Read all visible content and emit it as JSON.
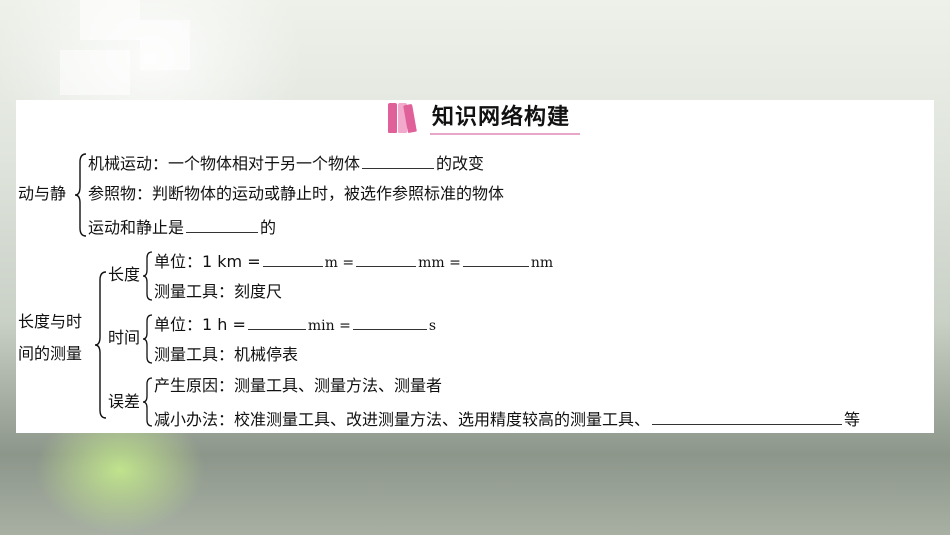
{
  "title": "知识网络构建",
  "section1": {
    "heading": "动与静",
    "line1_pre": "机械运动：一个物体相对于另一个物体",
    "line1_post": "的改变",
    "line2": "参照物：判断物体的运动或静止时，被选作参照标准的物体",
    "line3_pre": "运动和静止是",
    "line3_post": "的"
  },
  "section2": {
    "heading_line1": "长度与时",
    "heading_line2": "间的测量",
    "length": {
      "label": "长度",
      "unit_pre": "单位：1 km =",
      "m": "m =",
      "mm": "mm =",
      "nm": "nm",
      "tool": "测量工具：刻度尺"
    },
    "time": {
      "label": "时间",
      "unit_pre": "单位：1 h =",
      "min": "min =",
      "s": "s",
      "tool": "测量工具：机械停表"
    },
    "error": {
      "label": "误差",
      "cause": "产生原因：测量工具、测量方法、测量者",
      "reduce_pre": "减小办法：校准测量工具、改进测量方法、选用精度较高的测量工具、",
      "reduce_post": "等"
    }
  },
  "colors": {
    "book_pink": "#e0609a",
    "book_light": "#f2a9cb",
    "underline": "#e8a6c8"
  }
}
